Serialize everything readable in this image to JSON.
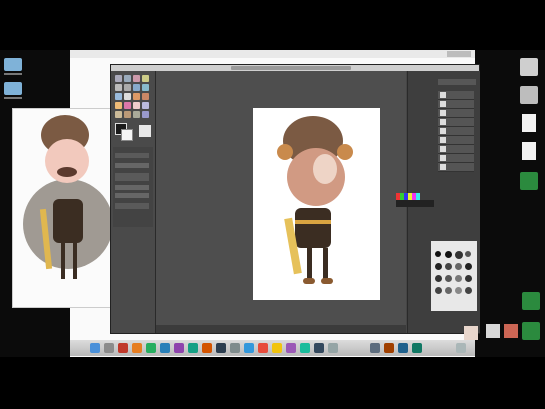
{
  "colors": {
    "desktop": "#0b0b0b",
    "gimp_bg": "#454545",
    "canvas_bg": "#4e4e4e",
    "toolbox": "#4a4a4a",
    "docks": "#3e3e3e",
    "image": "#ffffff",
    "skin": "#d19a83",
    "hair": "#7b5a43",
    "clothes": "#3b2d22"
  },
  "desktop_left": {
    "icons": [
      {
        "icon": "folder-icon"
      },
      {
        "icon": "folder-icon"
      }
    ]
  },
  "desktop_right": {
    "icons": [
      {
        "icon": "drive-icon"
      },
      {
        "icon": "drive-icon"
      },
      {
        "icon": "document-icon"
      },
      {
        "icon": "document-icon"
      },
      {
        "icon": "spreadsheet-icon"
      },
      {
        "icon": "spreadsheet-icon"
      },
      {
        "icon": "spreadsheet-icon"
      }
    ]
  },
  "gimp": {
    "layers": [
      "",
      "",
      "",
      "",
      "",
      "",
      "",
      ""
    ]
  },
  "dock": {
    "items": [
      "finder-icon",
      "app-icon",
      "app-icon",
      "app-icon",
      "app-icon",
      "app-icon",
      "app-icon",
      "app-icon",
      "app-icon",
      "app-icon",
      "app-icon",
      "app-icon",
      "app-icon",
      "app-icon",
      "app-icon",
      "app-icon",
      "app-icon",
      "app-icon",
      "app-icon",
      "app-icon",
      "app-icon",
      "app-icon",
      "trash-icon"
    ]
  }
}
